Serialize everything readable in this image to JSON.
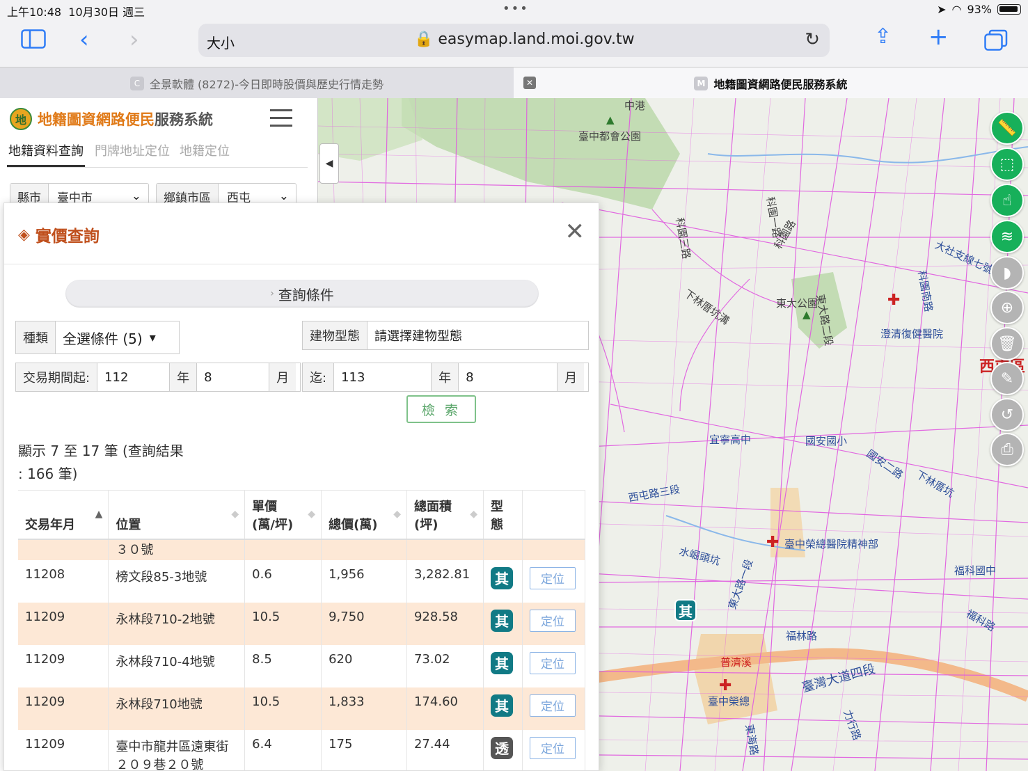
{
  "status": {
    "time": "上午10:48",
    "date": "10月30日 週三",
    "battery": "93%"
  },
  "browser": {
    "text_size": "大小",
    "url": "easymap.land.moi.gov.tw",
    "tabs": [
      {
        "favicon": "C",
        "title": "全景軟體 (8272)-今日即時股價與歷史行情走勢"
      },
      {
        "favicon": "M",
        "title": "地籍圖資網路便民服務系統"
      }
    ]
  },
  "site": {
    "title_a": "地籍圖資網路便民",
    "title_b": "服務系統",
    "logo_char": "地",
    "nav": [
      "地籍資料查詢",
      "門牌地址定位",
      "地籍定位"
    ],
    "county_label": "縣市",
    "county_value": "臺中市",
    "town_label": "鄉鎮市區",
    "town_value": "西屯"
  },
  "popup": {
    "title": "實價查詢",
    "conditions_label": "查詢條件",
    "type_label": "種類",
    "type_value": "全選條件 (5)",
    "building_label": "建物型態",
    "building_placeholder": "請選擇建物型態",
    "period_from_label": "交易期間起:",
    "from_year": "112",
    "year_unit": "年",
    "from_month": "8",
    "month_unit": "月",
    "period_to_label": "迄:",
    "to_year": "113",
    "to_month": "8",
    "search_label": "檢 索",
    "count_line1": "顯示 7 至 17 筆 (查詢結果",
    "count_line2": ": 166 筆)",
    "columns": [
      "交易年月",
      "位置",
      "單價\n(萬/坪)",
      "總價(萬)",
      "總面積\n(坪)",
      "型\n態",
      ""
    ],
    "partial_row": "３０號",
    "locate_label": "定位",
    "rows": [
      {
        "date": "11208",
        "location": "榜文段85-3地號",
        "unit_price": "0.6",
        "total": "1,956",
        "area": "3,282.81",
        "type": "其"
      },
      {
        "date": "11209",
        "location": "永林段710-2地號",
        "unit_price": "10.5",
        "total": "9,750",
        "area": "928.58",
        "type": "其"
      },
      {
        "date": "11209",
        "location": "永林段710-4地號",
        "unit_price": "8.5",
        "total": "620",
        "area": "73.02",
        "type": "其"
      },
      {
        "date": "11209",
        "location": "永林段710地號",
        "unit_price": "10.5",
        "total": "1,833",
        "area": "174.60",
        "type": "其"
      },
      {
        "date": "11209",
        "location": "臺中市龍井區遠東街２０９巷２０號",
        "unit_price": "6.4",
        "total": "175",
        "area": "27.44",
        "type": "透"
      }
    ]
  },
  "map": {
    "labels": [
      "臺中都會公園",
      "科園三路",
      "科園一路",
      "科園路",
      "東大公園",
      "下林厝坑溝",
      "東大路二段",
      "澄清復健醫院",
      "宜寧高中",
      "國安國小",
      "國安二路",
      "下林厝坑",
      "西屯路三段",
      "水崛頭坑",
      "臺中榮總醫院精神部",
      "福科國中",
      "臺灣大道四段",
      "臺中榮總",
      "東大路一段",
      "福林路",
      "東海路",
      "大社支線七號",
      "科園南路",
      "西屯區",
      "中港",
      "福科路",
      "普濟溪",
      "力行路"
    ],
    "marker_badge": "其"
  }
}
